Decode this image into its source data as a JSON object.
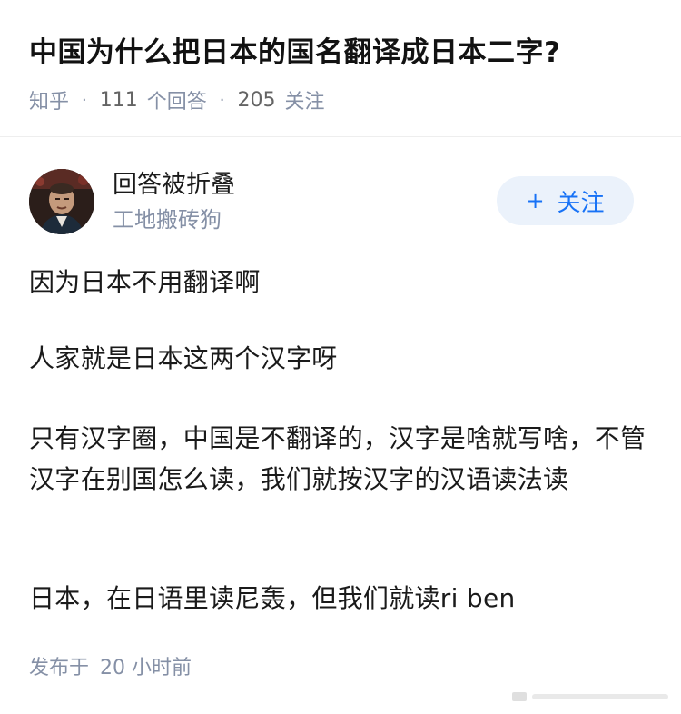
{
  "question": {
    "title": "中国为什么把日本的国名翻译成日本二字?",
    "source": "知乎",
    "answers_count": "111",
    "answers_label": "个回答",
    "followers_count": "205",
    "followers_label": "关注"
  },
  "answer": {
    "author_name": "回答被折叠",
    "author_sub": "工地搬砖狗",
    "follow_button": "关注",
    "paragraphs": [
      "因为日本不用翻译啊",
      "人家就是日本这两个汉字呀",
      "只有汉字圈，中国是不翻译的，汉字是啥就写啥，不管汉字在别国怎么读，我们就按汉字的汉语读法读",
      "日本，在日语里读尼轰，但我们就读ri ben"
    ],
    "published_label": "发布于",
    "published_time": "20 小时前"
  },
  "colors": {
    "accent": "#1772f6",
    "follow_bg": "#ebf2fb",
    "meta_gray": "#8590a6"
  }
}
